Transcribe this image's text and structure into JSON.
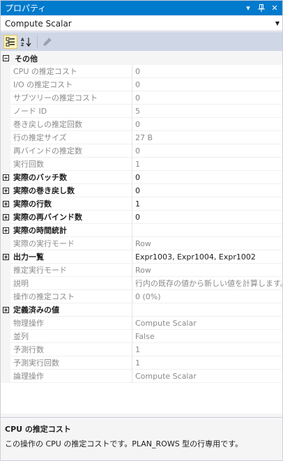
{
  "window": {
    "title": "プロパティ",
    "dropdown_glyph": "▾",
    "pin_glyph": "ᵖ",
    "close_glyph": "✕"
  },
  "object_selector": {
    "value": "Compute Scalar"
  },
  "toolbar": {
    "buttons": [
      {
        "icon": "categorized-icon",
        "active": true
      },
      {
        "icon": "alphabetical-icon",
        "active": false
      },
      {
        "icon": "property-pages-icon",
        "active": false
      }
    ]
  },
  "grid": {
    "rows": [
      {
        "type": "category",
        "label": "その他",
        "expanded": true
      },
      {
        "type": "prop",
        "name": "CPU の推定コスト",
        "value": "0",
        "style": "dim"
      },
      {
        "type": "prop",
        "name": "I/O の推定コスト",
        "value": "0",
        "style": "dim"
      },
      {
        "type": "prop",
        "name": "サブツリーの推定コスト",
        "value": "0",
        "style": "dim"
      },
      {
        "type": "prop",
        "name": "ノード ID",
        "value": "5",
        "style": "dim"
      },
      {
        "type": "prop",
        "name": "巻き戻しの推定回数",
        "value": "0",
        "style": "dim"
      },
      {
        "type": "prop",
        "name": "行の推定サイズ",
        "value": "27 B",
        "style": "dim"
      },
      {
        "type": "prop",
        "name": "再バインドの推定数",
        "value": "0",
        "style": "dim"
      },
      {
        "type": "prop",
        "name": "実行回数",
        "value": "1",
        "style": "dim"
      },
      {
        "type": "prop",
        "name": "実際のバッチ数",
        "value": "0",
        "style": "bold",
        "expandable": true
      },
      {
        "type": "prop",
        "name": "実際の巻き戻し数",
        "value": "0",
        "style": "bold",
        "expandable": true
      },
      {
        "type": "prop",
        "name": "実際の行数",
        "value": "1",
        "style": "bold",
        "expandable": true
      },
      {
        "type": "prop",
        "name": "実際の再バインド数",
        "value": "0",
        "style": "bold",
        "expandable": true
      },
      {
        "type": "prop",
        "name": "実際の時間統計",
        "value": "",
        "style": "bold",
        "expandable": true
      },
      {
        "type": "prop",
        "name": "実際の実行モード",
        "value": "Row",
        "style": "dim"
      },
      {
        "type": "prop",
        "name": "出力一覧",
        "value": "Expr1003, Expr1004, Expr1002",
        "style": "bold",
        "expandable": true
      },
      {
        "type": "prop",
        "name": "推定実行モード",
        "value": "Row",
        "style": "dim"
      },
      {
        "type": "prop",
        "name": "説明",
        "value": "行内の既存の値から新しい値を計算します。",
        "style": "dim"
      },
      {
        "type": "prop",
        "name": "操作の推定コスト",
        "value": "0 (0%)",
        "style": "dim"
      },
      {
        "type": "prop",
        "name": "定義済みの値",
        "value": "",
        "style": "bold",
        "expandable": true
      },
      {
        "type": "prop",
        "name": "物理操作",
        "value": "Compute Scalar",
        "style": "dim"
      },
      {
        "type": "prop",
        "name": "並列",
        "value": "False",
        "style": "dim"
      },
      {
        "type": "prop",
        "name": "予測行数",
        "value": "1",
        "style": "dim"
      },
      {
        "type": "prop",
        "name": "予測実行回数",
        "value": "1",
        "style": "dim"
      },
      {
        "type": "prop",
        "name": "論理操作",
        "value": "Compute Scalar",
        "style": "dim"
      }
    ]
  },
  "description": {
    "title": "CPU の推定コスト",
    "text": "この操作の CPU の推定コストです。PLAN_ROWS 型の行専用です。"
  },
  "colors": {
    "titlebar": "#007acc",
    "toolbar": "#cfd6e5",
    "dim_text": "#8a8a8a"
  }
}
